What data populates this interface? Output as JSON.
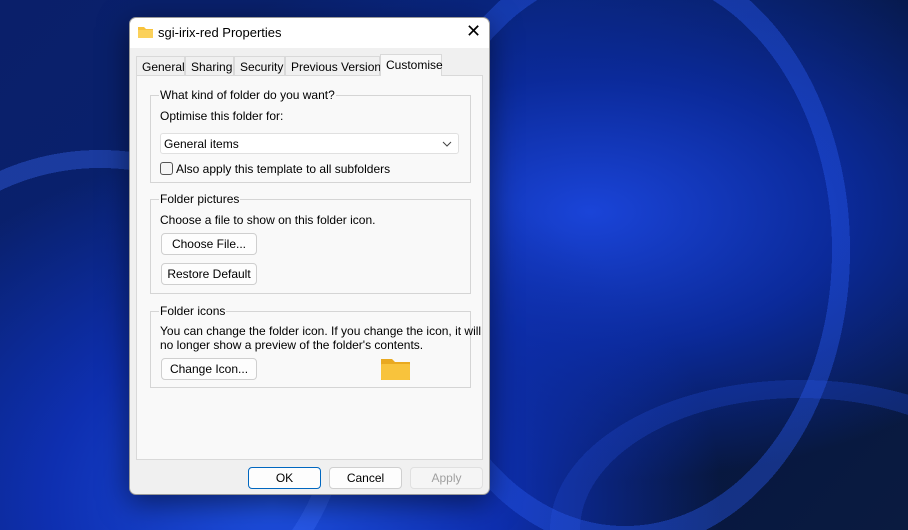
{
  "window": {
    "title": "sgi-irix-red Properties"
  },
  "tabs": [
    {
      "label": "General"
    },
    {
      "label": "Sharing"
    },
    {
      "label": "Security"
    },
    {
      "label": "Previous Versions"
    },
    {
      "label": "Customise"
    }
  ],
  "folder_type": {
    "legend": "What kind of folder do you want?",
    "optimise_label": "Optimise this folder for:",
    "selected": "General items",
    "apply_subfolders_label": "Also apply this template to all subfolders",
    "apply_subfolders_checked": false
  },
  "folder_pictures": {
    "legend": "Folder pictures",
    "description": "Choose a file to show on this folder icon.",
    "choose_file": "Choose File...",
    "restore_default": "Restore Default"
  },
  "folder_icons": {
    "legend": "Folder icons",
    "description_line1": "You can change the folder icon. If you change the icon, it will",
    "description_line2": "no longer show a preview of the folder's contents.",
    "change_icon": "Change Icon..."
  },
  "footer": {
    "ok": "OK",
    "cancel": "Cancel",
    "apply": "Apply"
  },
  "colors": {
    "accent": "#0067c0",
    "folder": "#f8c33c"
  }
}
